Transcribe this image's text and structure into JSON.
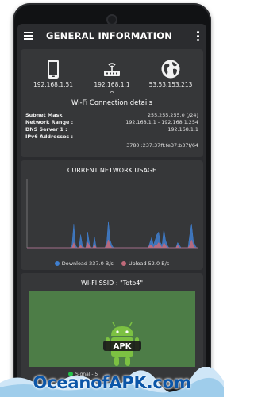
{
  "app": {
    "title": "GENERAL INFORMATION"
  },
  "network_items": [
    {
      "icon": "phone-icon",
      "ip": "192.168.1.51"
    },
    {
      "icon": "router-icon",
      "ip": "192.168.1.1"
    },
    {
      "icon": "globe-icon",
      "ip": "53.53.153.213"
    }
  ],
  "connection": {
    "caret": "^",
    "title": "Wi-Fi Connection details",
    "rows": [
      {
        "key": "Subnet Mask",
        "value": "255.255.255.0 (/24)"
      },
      {
        "key": "Network Range :",
        "value": "192.168.1.1 - 192.168.1.254"
      },
      {
        "key": "DNS Server 1 :",
        "value": "192.168.1.1"
      },
      {
        "key": "IPv6 Addresses :",
        "value": ""
      }
    ],
    "ipv6": "3780::237:37ff:fe37:b37f/64"
  },
  "usage": {
    "title": "CURRENT NETWORK USAGE",
    "download_label": "Download 237.0  B/s",
    "upload_label": "Upload 52.0  B/s",
    "download_color": "#3f7fd0",
    "upload_color": "#c06a7a"
  },
  "wifi": {
    "title": "WI-FI SSID :  \"Toto4\"",
    "signal_label": "Signal - 5",
    "signal_color": "#22c34a",
    "area_color": "#4d7d47"
  },
  "watermark": {
    "text": "OceanofAPK.com",
    "badge": "APK"
  },
  "chart_data": {
    "type": "area",
    "title": "CURRENT NETWORK USAGE",
    "series": [
      {
        "name": "Download 237.0  B/s",
        "values": [
          0,
          0,
          0,
          0,
          0,
          0,
          0,
          0,
          0,
          0,
          0,
          0,
          0,
          0,
          0,
          0,
          0,
          0,
          0,
          0,
          0,
          0,
          0,
          0,
          0,
          0,
          1,
          9,
          1,
          0,
          0,
          5,
          1,
          0,
          0,
          6,
          2,
          0,
          0,
          4,
          0,
          0,
          0,
          0,
          0,
          0,
          2,
          10,
          3,
          1,
          0,
          0,
          0,
          0,
          0,
          0,
          0,
          0,
          0,
          0,
          0,
          0,
          0,
          0,
          0,
          0,
          0,
          0,
          0,
          0,
          0,
          2,
          4,
          1,
          3,
          5,
          6,
          2,
          1,
          7,
          3,
          1,
          0,
          0,
          0,
          0,
          0,
          2,
          1,
          0,
          0,
          0,
          0,
          0,
          5,
          9,
          3,
          1,
          0,
          0
        ]
      },
      {
        "name": "Upload 52.0  B/s",
        "values": [
          0,
          0,
          0,
          0,
          0,
          0,
          0,
          0,
          0,
          0,
          0,
          0,
          0,
          0,
          0,
          0,
          0,
          0,
          0,
          0,
          0,
          0,
          0,
          0,
          0,
          0,
          0,
          2,
          0,
          0,
          0,
          1,
          0,
          0,
          0,
          2,
          1,
          0,
          0,
          1,
          0,
          0,
          0,
          0,
          0,
          0,
          1,
          3,
          1,
          0,
          0,
          0,
          0,
          0,
          0,
          0,
          0,
          0,
          0,
          0,
          0,
          0,
          0,
          0,
          0,
          0,
          0,
          0,
          0,
          0,
          0,
          1,
          1,
          0,
          1,
          1,
          2,
          1,
          0,
          2,
          1,
          0,
          0,
          0,
          0,
          0,
          0,
          1,
          0,
          0,
          0,
          0,
          0,
          0,
          1,
          3,
          1,
          0,
          0,
          0
        ]
      }
    ],
    "ylim": [
      0,
      26
    ]
  }
}
